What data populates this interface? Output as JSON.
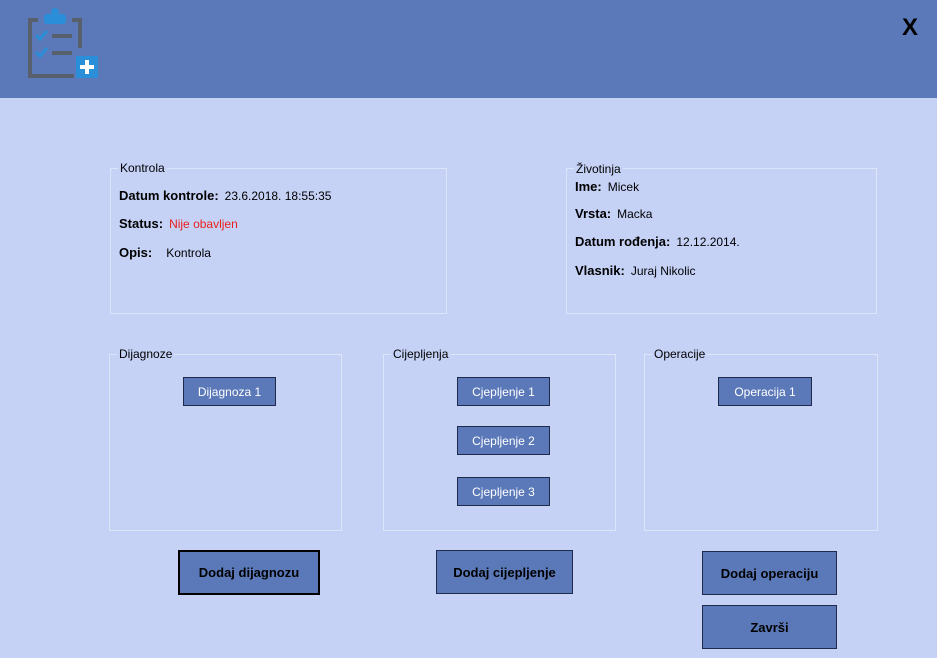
{
  "header": {
    "close_label": "X",
    "icon": "clipboard-checklist-plus-icon"
  },
  "kontrola": {
    "title": "Kontrola",
    "datum_label": "Datum kontrole:",
    "datum_value": "23.6.2018. 18:55:35",
    "status_label": "Status:",
    "status_value": "Nije obavljen",
    "opis_label": "Opis:",
    "opis_value": "Kontrola"
  },
  "zivotinja": {
    "title": "Životinja",
    "ime_label": "Ime:",
    "ime_value": "Micek",
    "vrsta_label": "Vrsta:",
    "vrsta_value": "Macka",
    "datum_label": "Datum rođenja:",
    "datum_value": "12.12.2014.",
    "vlasnik_label": "Vlasnik:",
    "vlasnik_value": "Juraj Nikolic"
  },
  "dijagnoze": {
    "title": "Dijagnoze",
    "items": [
      "Dijagnoza 1"
    ]
  },
  "cijepljenja": {
    "title": "Cijepljenja",
    "items": [
      "Cjepljenje 1",
      "Cjepljenje 2",
      "Cjepljenje 3"
    ]
  },
  "operacije": {
    "title": "Operacije",
    "items": [
      "Operacija 1"
    ]
  },
  "actions": {
    "add_dijagnoza": "Dodaj dijagnozu",
    "add_cijepljenje": "Dodaj cijepljenje",
    "add_operacija": "Dodaj operaciju",
    "finish": "Završi"
  },
  "colors": {
    "header": "#5b79b9",
    "background": "#c5d2f6",
    "button": "#5b79b9",
    "status_red": "#e8201d",
    "icon_blue": "#2a8fd8",
    "icon_gray": "#58616b"
  }
}
